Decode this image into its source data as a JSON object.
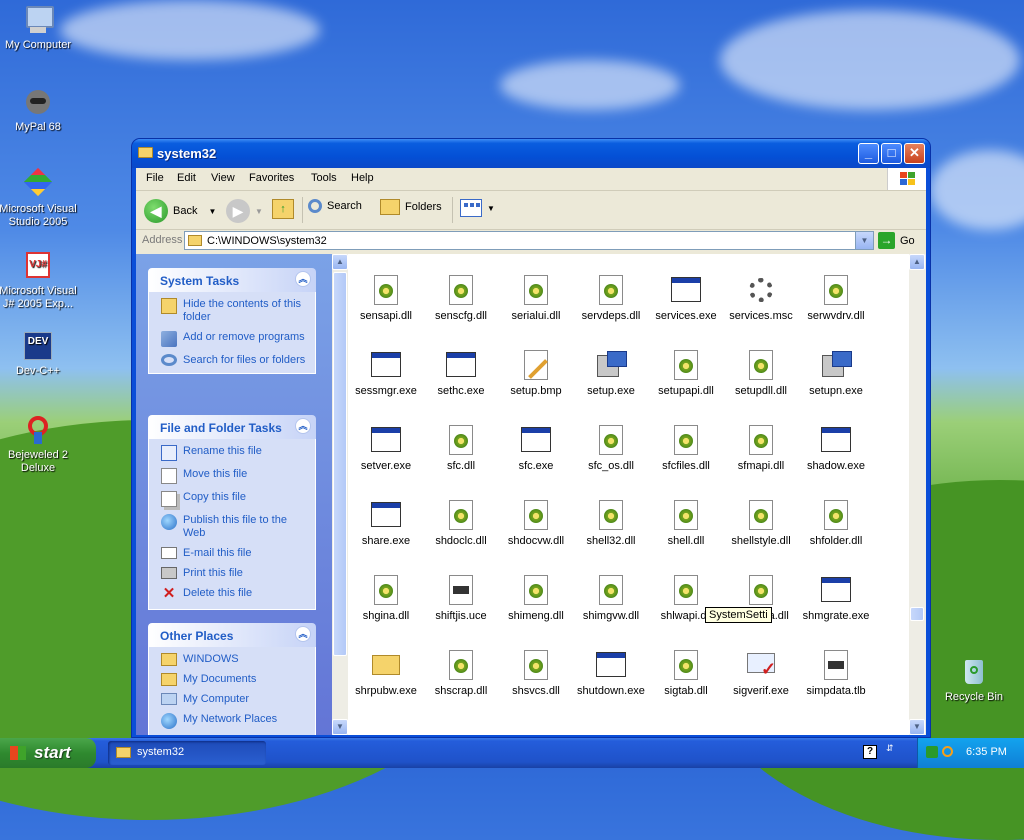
{
  "desktop": {
    "icons": [
      {
        "label": "My Computer",
        "icon": "computer-icon"
      },
      {
        "label": "MyPal 68",
        "icon": "mypal-icon"
      },
      {
        "label": "Microsoft Visual Studio 2005",
        "icon": "visual-studio-icon"
      },
      {
        "label": "Microsoft Visual J# 2005 Exp...",
        "icon": "visual-jsharp-icon"
      },
      {
        "label": "Dev-C++",
        "icon": "devcpp-icon"
      },
      {
        "label": "Bejeweled 2 Deluxe",
        "icon": "bejeweled-icon"
      },
      {
        "label": "Recycle Bin",
        "icon": "recycle-bin-icon"
      }
    ]
  },
  "window": {
    "title": "system32",
    "menu": [
      "File",
      "Edit",
      "View",
      "Favorites",
      "Tools",
      "Help"
    ],
    "toolbar": {
      "back": "Back",
      "search": "Search",
      "folders": "Folders"
    },
    "address": {
      "label": "Address",
      "value": "C:\\WINDOWS\\system32",
      "go": "Go"
    }
  },
  "left_pane": {
    "system_tasks": {
      "title": "System Tasks",
      "items": [
        "Hide the contents of this folder",
        "Add or remove programs",
        "Search for files or folders"
      ]
    },
    "file_folder_tasks": {
      "title": "File and Folder Tasks",
      "items": [
        "Rename this file",
        "Move this file",
        "Copy this file",
        "Publish this file to the Web",
        "E-mail this file",
        "Print this file",
        "Delete this file"
      ]
    },
    "other_places": {
      "title": "Other Places",
      "items": [
        "WINDOWS",
        "My Documents",
        "My Computer",
        "My Network Places"
      ]
    }
  },
  "files": [
    [
      "sensapi.dll",
      "senscfg.dll",
      "serialui.dll",
      "servdeps.dll",
      "services.exe",
      "services.msc",
      "serwvdrv.dll"
    ],
    [
      "sessmgr.exe",
      "sethc.exe",
      "setup.bmp",
      "setup.exe",
      "setupapi.dll",
      "setupdll.dll",
      "setupn.exe"
    ],
    [
      "setver.exe",
      "sfc.dll",
      "sfc.exe",
      "sfc_os.dll",
      "sfcfiles.dll",
      "sfmapi.dll",
      "shadow.exe"
    ],
    [
      "share.exe",
      "shdoclc.dll",
      "shdocvw.dll",
      "shell32.dll",
      "shell.dll",
      "shellstyle.dll",
      "shfolder.dll"
    ],
    [
      "shgina.dll",
      "shiftjis.uce",
      "shimeng.dll",
      "shimgvw.dll",
      "shlwapi.dll",
      "shmedia.dll",
      "shmgrate.exe"
    ],
    [
      "shrpubw.exe",
      "shscrap.dll",
      "shsvcs.dll",
      "shutdown.exe",
      "sigtab.dll",
      "sigverif.exe",
      "simpdata.tlb"
    ]
  ],
  "file_types": [
    [
      "dll",
      "dll",
      "dll",
      "dll",
      "exe",
      "msc",
      "dll"
    ],
    [
      "exe",
      "exe",
      "bmp",
      "setup",
      "dll",
      "dll",
      "setup"
    ],
    [
      "exe",
      "dll",
      "exe",
      "dll",
      "dll",
      "dll",
      "exe"
    ],
    [
      "exe",
      "dll",
      "dll",
      "dll",
      "dll",
      "dll",
      "dll"
    ],
    [
      "dll",
      "uce",
      "dll",
      "dll",
      "dll",
      "dll",
      "exe"
    ],
    [
      "pubw",
      "dll",
      "dll",
      "exe",
      "dll",
      "sigverif",
      "tlb"
    ]
  ],
  "tooltip": "SystemSetti",
  "taskbar": {
    "start": "start",
    "task_label": "system32",
    "clock": "6:35 PM"
  }
}
